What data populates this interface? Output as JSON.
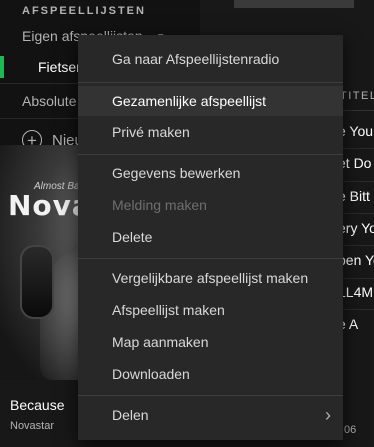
{
  "sidebar": {
    "section_title": "AFSPEELLIJSTEN",
    "own_playlists": "Eigen afspeellijsten",
    "playlists": [
      "Fietsen",
      "Absolute"
    ],
    "new_playlist": "Nieuwe afspeellijst",
    "album_text_small": "Almost Bang",
    "album_text_big": "Novas",
    "now_playing_title": "Because",
    "now_playing_artist": "Novastar",
    "accent_color": "#1db954"
  },
  "main": {
    "column_header": "TITEL",
    "tracks": [
      "e You",
      "et Do",
      "e Bitt",
      "ery Yo",
      "pen Yo",
      "LL4M",
      "e A"
    ],
    "time_fragment": "06"
  },
  "context_menu": {
    "items": [
      {
        "label": "Ga naar Afspeellijstenradio",
        "state": "normal"
      },
      {
        "label": "Gezamenlijke afspeellijst",
        "state": "hover"
      },
      {
        "label": "Privé maken",
        "state": "normal"
      },
      {
        "label": "Gegevens bewerken",
        "state": "normal"
      },
      {
        "label": "Melding maken",
        "state": "disabled"
      },
      {
        "label": "Delete",
        "state": "normal"
      },
      {
        "label": "Vergelijkbare afspeellijst maken",
        "state": "normal"
      },
      {
        "label": "Afspeellijst maken",
        "state": "normal"
      },
      {
        "label": "Map aanmaken",
        "state": "normal"
      },
      {
        "label": "Downloaden",
        "state": "normal"
      },
      {
        "label": "Delen",
        "state": "normal",
        "submenu_icon": "chevron-right-icon"
      }
    ]
  }
}
